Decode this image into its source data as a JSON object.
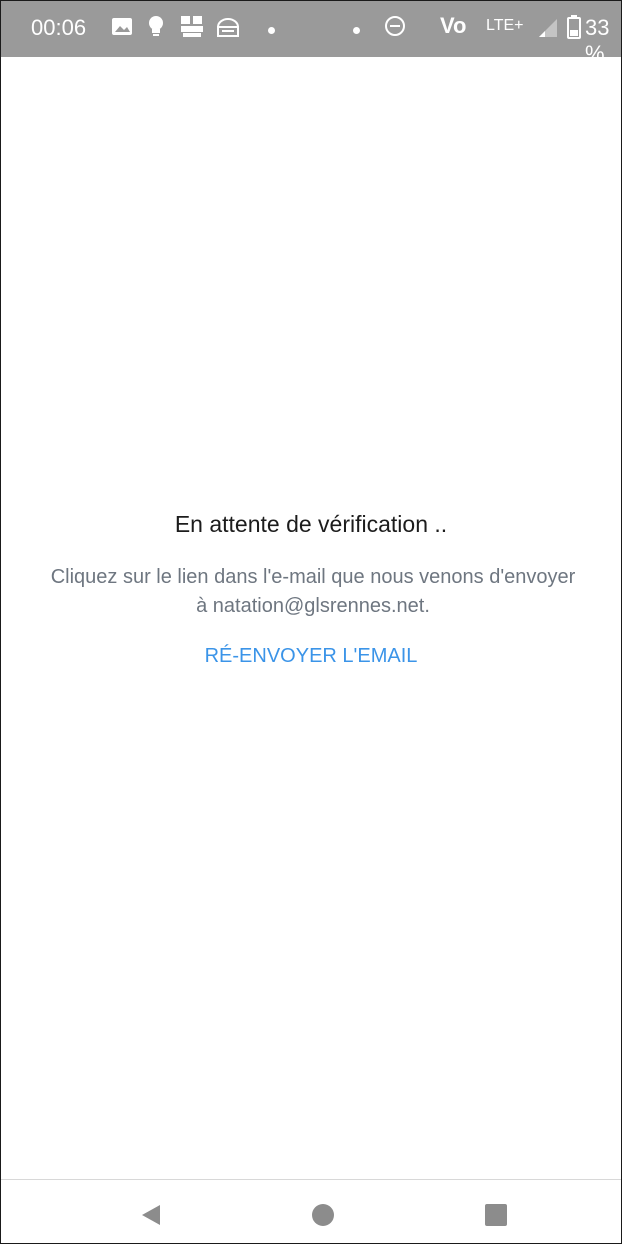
{
  "status_bar": {
    "time": "00:06",
    "network_label": "Vo",
    "network_type": "LTE+",
    "battery": "33 %",
    "icons": [
      "image-icon",
      "bulb-icon",
      "stopcovid-icon",
      "keyboard-icon",
      "dot-icon",
      "dot-icon",
      "do-not-disturb-icon",
      "volte-icon",
      "lte-plus-icon",
      "signal-icon",
      "battery-icon"
    ]
  },
  "verification": {
    "title": "En attente de vérification ..",
    "message_line1": "Cliquez sur le lien dans l'e-mail que nous venons d'envoyer",
    "message_line2": "à natation@glsrennes.net.",
    "resend_label": "RÉ-ENVOYER L'EMAIL"
  },
  "colors": {
    "status_bar": "#9a9a9a",
    "link": "#3b94e8",
    "title": "#1c1c1c",
    "muted": "#6e7680",
    "nav_icon": "#8c8c8c"
  },
  "nav_bar": {
    "icons": [
      "back-icon",
      "home-icon",
      "recents-icon"
    ]
  }
}
